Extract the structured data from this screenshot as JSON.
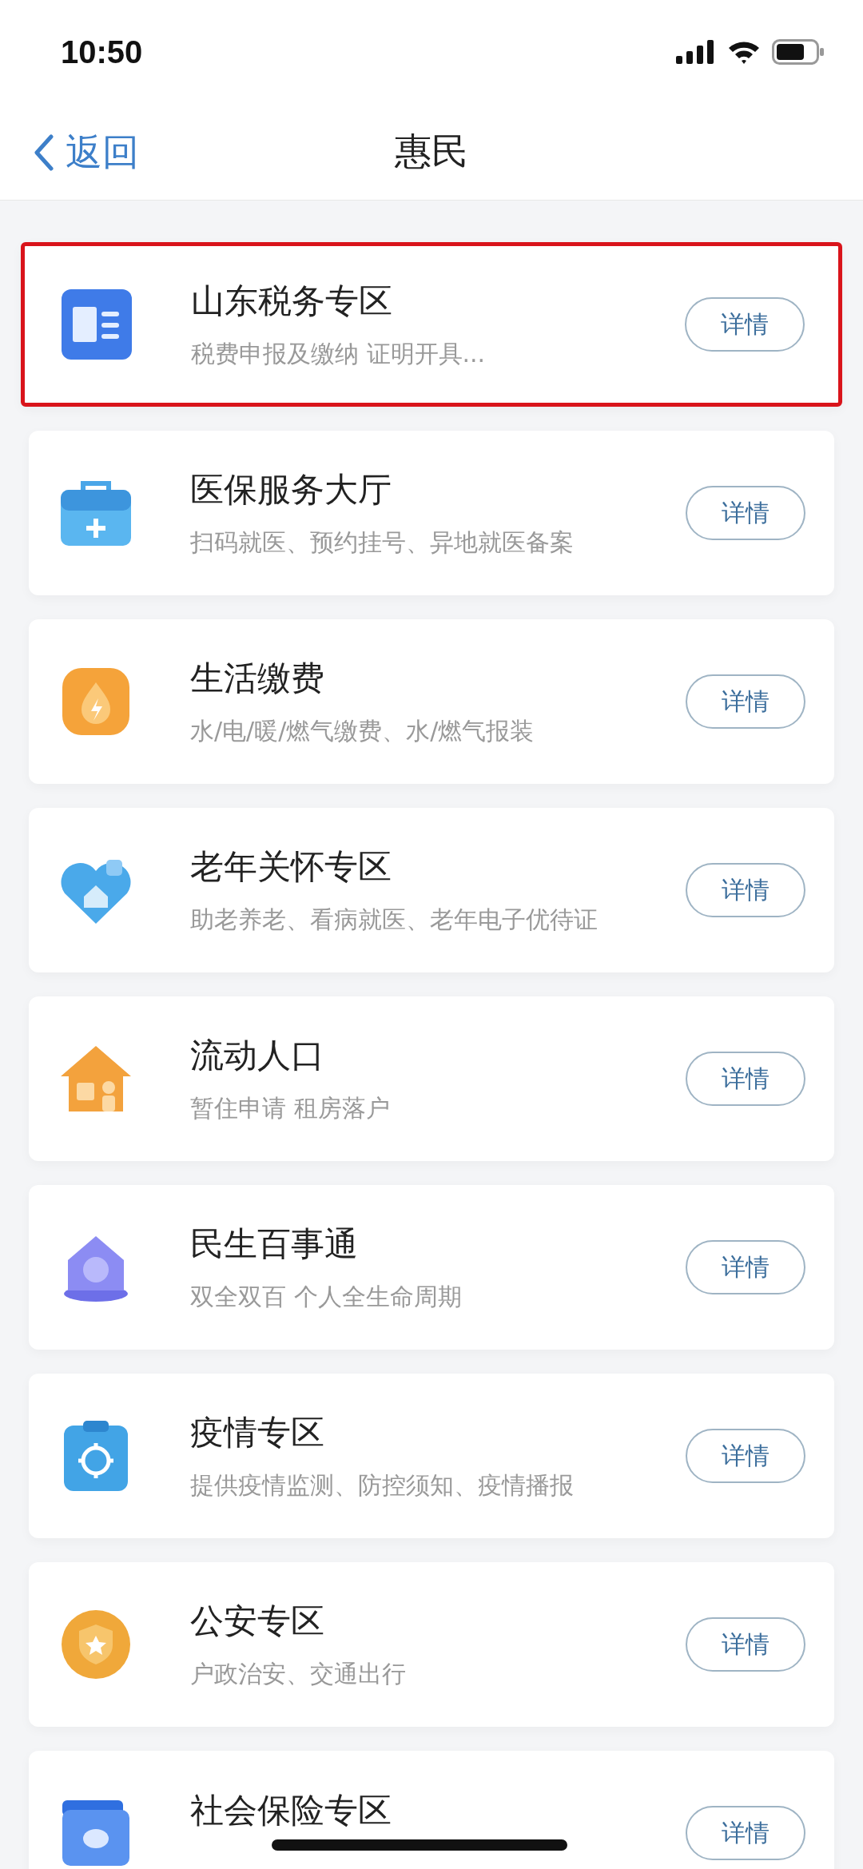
{
  "status_bar": {
    "time": "10:50"
  },
  "nav": {
    "back": "返回",
    "title": "惠民"
  },
  "services": [
    {
      "title": "山东税务专区",
      "subtitle": "税费申报及缴纳  证明开具...",
      "button": "详情",
      "highlighted": true
    },
    {
      "title": "医保服务大厅",
      "subtitle": "扫码就医、预约挂号、异地就医备案",
      "button": "详情",
      "highlighted": false
    },
    {
      "title": "生活缴费",
      "subtitle": "水/电/暖/燃气缴费、水/燃气报装",
      "button": "详情",
      "highlighted": false
    },
    {
      "title": "老年关怀专区",
      "subtitle": "助老养老、看病就医、老年电子优待证",
      "button": "详情",
      "highlighted": false
    },
    {
      "title": "流动人口",
      "subtitle": "暂住申请 租房落户",
      "button": "详情",
      "highlighted": false
    },
    {
      "title": "民生百事通",
      "subtitle": "双全双百 个人全生命周期",
      "button": "详情",
      "highlighted": false
    },
    {
      "title": "疫情专区",
      "subtitle": "提供疫情监测、防控须知、疫情播报",
      "button": "详情",
      "highlighted": false
    },
    {
      "title": "公安专区",
      "subtitle": "户政治安、交通出行",
      "button": "详情",
      "highlighted": false
    },
    {
      "title": "社会保险专区",
      "button": "详情",
      "highlighted": false
    }
  ]
}
